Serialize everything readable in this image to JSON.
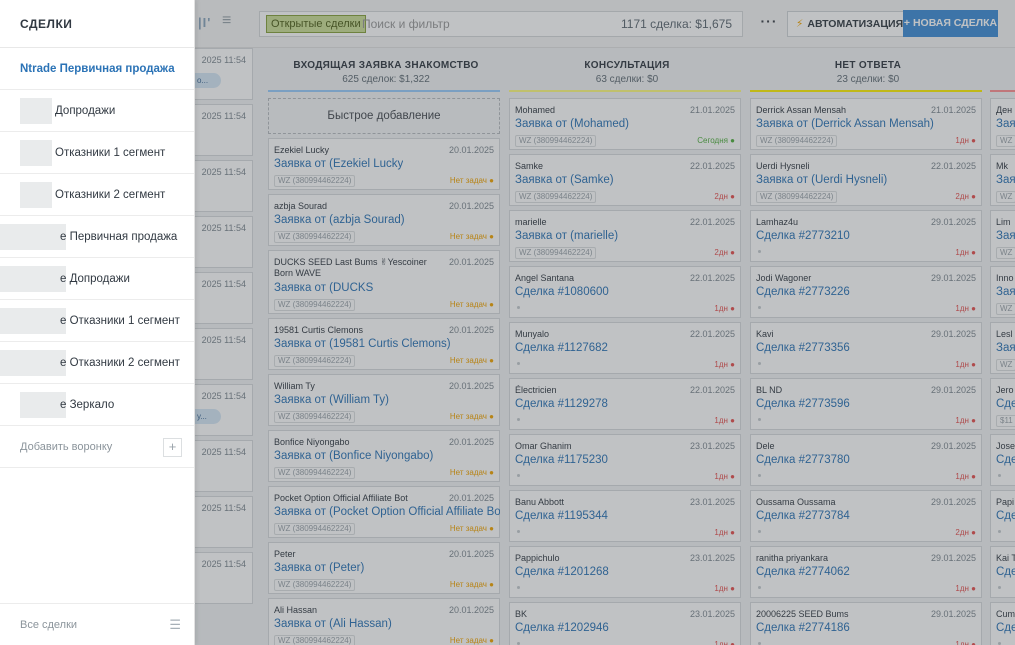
{
  "topbar": {
    "logo_text": "|I'",
    "filter_chip": "Открытые сделки",
    "search_placeholder": "Поиск и фильтр",
    "deal_count": "1171 сделка: $1,675",
    "more_label": "···",
    "automation_label": "АВТОМАТИЗАЦИЯ",
    "new_deal_label": "+ НОВАЯ СДЕЛКА"
  },
  "hidden_column": {
    "dates": [
      "2025 11:54",
      "2025 11:54",
      "2025 11:54",
      "2025 11:54",
      "2025 11:54",
      "2025 11:54",
      "2025 11:54",
      "2025 11:54",
      "2025 11:54",
      "2025 11:54"
    ],
    "badges": [
      "o...",
      "",
      "",
      "",
      "",
      "",
      "у...",
      "",
      "",
      ""
    ]
  },
  "columns": [
    {
      "title": "ВХОДЯЩАЯ ЗАЯВКА ЗНАКОМСТВО",
      "summary": "625 сделок: $1,322",
      "color": "#99ccfd",
      "quick_add": "Быстрое добавление",
      "cards": [
        {
          "name": "Ezekiel Lucky",
          "date": "20.01.2025",
          "title": "Заявка от (Ezekiel Lucky",
          "tag": "WZ (380994462224)",
          "status": "Нет задач",
          "status_color": "orange"
        },
        {
          "name": "azbja Sourad",
          "date": "20.01.2025",
          "title": "Заявка от (azbja Sourad)",
          "tag": "WZ (380994462224)",
          "status": "Нет задач",
          "status_color": "orange"
        },
        {
          "name": "DUCKS SEED Last Bums ✌Yescoiner Born WAVE",
          "date": "20.01.2025",
          "title": "Заявка от (DUCKS",
          "tag": "WZ (380994462224)",
          "status": "Нет задач",
          "status_color": "orange",
          "tall": true
        },
        {
          "name": "19581 Curtis Clemons",
          "date": "20.01.2025",
          "title": "Заявка от (19581 Curtis Clemons)",
          "tag": "WZ (380994462224)",
          "status": "Нет задач",
          "status_color": "orange"
        },
        {
          "name": "William Ty",
          "date": "20.01.2025",
          "title": "Заявка от (William Ty)",
          "tag": "WZ (380994462224)",
          "status": "Нет задач",
          "status_color": "orange"
        },
        {
          "name": "Bonfice Niyongabo",
          "date": "20.01.2025",
          "title": "Заявка от (Bonfice Niyongabo)",
          "tag": "WZ (380994462224)",
          "status": "Нет задач",
          "status_color": "orange"
        },
        {
          "name": "Pocket Option Official Affiliate Bot",
          "date": "20.01.2025",
          "title": "Заявка от (Pocket Option Official Affiliate Bot)",
          "tag": "WZ (380994462224)",
          "status": "Нет задач",
          "status_color": "orange"
        },
        {
          "name": "Peter",
          "date": "20.01.2025",
          "title": "Заявка от (Peter)",
          "tag": "WZ (380994462224)",
          "status": "Нет задач",
          "status_color": "orange"
        },
        {
          "name": "Ali Hassan",
          "date": "20.01.2025",
          "title": "Заявка от (Ali Hassan)",
          "tag": "WZ (380994462224)",
          "status": "Нет задач",
          "status_color": "orange"
        }
      ]
    },
    {
      "title": "КОНСУЛЬТАЦИЯ",
      "summary": "63 сделки: $0",
      "color": "#fffd7f",
      "cards": [
        {
          "name": "Mohamed",
          "date": "21.01.2025",
          "title": "Заявка от (Mohamed)",
          "tag": "WZ (380994462224)",
          "status": "Сегодня",
          "status_color": "green"
        },
        {
          "name": "Samke",
          "date": "22.01.2025",
          "title": "Заявка от (Samke)",
          "tag": "WZ (380994462224)",
          "status": "2дн",
          "status_color": "red"
        },
        {
          "name": "marielle",
          "date": "22.01.2025",
          "title": "Заявка от (marielle)",
          "tag": "WZ (380994462224)",
          "status": "2дн",
          "status_color": "red"
        },
        {
          "name": "Angel Santana",
          "date": "22.01.2025",
          "title": "Сделка #1080600",
          "tag": "",
          "status": "1дн",
          "status_color": "red"
        },
        {
          "name": "Munyalo",
          "date": "22.01.2025",
          "title": "Сделка #1127682",
          "tag": "",
          "status": "1дн",
          "status_color": "red"
        },
        {
          "name": "Électricien",
          "date": "22.01.2025",
          "title": "Сделка #1129278",
          "tag": "",
          "status": "1дн",
          "status_color": "red"
        },
        {
          "name": "Omar Ghanim",
          "date": "23.01.2025",
          "title": "Сделка #1175230",
          "tag": "",
          "status": "1дн",
          "status_color": "red"
        },
        {
          "name": "Banu Abbott",
          "date": "23.01.2025",
          "title": "Сделка #1195344",
          "tag": "",
          "status": "1дн",
          "status_color": "red"
        },
        {
          "name": "Pappichulo",
          "date": "23.01.2025",
          "title": "Сделка #1201268",
          "tag": "",
          "status": "1дн",
          "status_color": "red"
        },
        {
          "name": "BK",
          "date": "23.01.2025",
          "title": "Сделка #1202946",
          "tag": "",
          "status": "1дн",
          "status_color": "red"
        }
      ]
    },
    {
      "title": "НЕТ ОТВЕТА",
      "summary": "23 сделки: $0",
      "color": "#fff000",
      "cards": [
        {
          "name": "Derrick Assan Mensah",
          "date": "21.01.2025",
          "title": "Заявка от (Derrick Assan Mensah)",
          "tag": "WZ (380994462224)",
          "status": "1дн",
          "status_color": "red"
        },
        {
          "name": "Uerdi Hysneli",
          "date": "22.01.2025",
          "title": "Заявка от (Uerdi Hysneli)",
          "tag": "WZ (380994462224)",
          "status": "2дн",
          "status_color": "red"
        },
        {
          "name": "Lamhaz4u",
          "date": "29.01.2025",
          "title": "Сделка #2773210",
          "tag": "",
          "status": "1дн",
          "status_color": "red"
        },
        {
          "name": "Jodi Wagoner",
          "date": "29.01.2025",
          "title": "Сделка #2773226",
          "tag": "",
          "status": "1дн",
          "status_color": "red"
        },
        {
          "name": "Kavi",
          "date": "29.01.2025",
          "title": "Сделка #2773356",
          "tag": "",
          "status": "1дн",
          "status_color": "red"
        },
        {
          "name": "BL ND",
          "date": "29.01.2025",
          "title": "Сделка #2773596",
          "tag": "",
          "status": "1дн",
          "status_color": "red"
        },
        {
          "name": "Dele",
          "date": "29.01.2025",
          "title": "Сделка #2773780",
          "tag": "",
          "status": "1дн",
          "status_color": "red"
        },
        {
          "name": "Oussama Oussama",
          "date": "29.01.2025",
          "title": "Сделка #2773784",
          "tag": "",
          "status": "2дн",
          "status_color": "red"
        },
        {
          "name": "ranitha priyankara",
          "date": "29.01.2025",
          "title": "Сделка #2774062",
          "tag": "",
          "status": "1дн",
          "status_color": "red"
        },
        {
          "name": "20006225 SEED Bums",
          "date": "29.01.2025",
          "title": "Сделка #2774186",
          "tag": "",
          "status": "1дн",
          "status_color": "red"
        }
      ]
    },
    {
      "title": "",
      "summary": "",
      "color": "#ff8f92",
      "cards": [
        {
          "name": "Ден",
          "date": "",
          "title": "Заяв",
          "tag": "WZ",
          "status": "",
          "status_color": "red"
        },
        {
          "name": "Mk",
          "date": "",
          "title": "Заяв",
          "tag": "WZ",
          "status": "",
          "status_color": "red"
        },
        {
          "name": "Lim",
          "date": "",
          "title": "Заяв",
          "tag": "WZ",
          "status": "",
          "status_color": "red"
        },
        {
          "name": "Inno",
          "date": "",
          "title": "Заяв",
          "tag": "WZ",
          "status": "",
          "status_color": "red"
        },
        {
          "name": "Lesl",
          "date": "",
          "title": "Заяв",
          "tag": "WZ",
          "status": "",
          "status_color": "red"
        },
        {
          "name": "Jero",
          "date": "",
          "title": "Сде",
          "tag": "$11",
          "status": "",
          "status_color": "red"
        },
        {
          "name": "Jose",
          "date": "",
          "title": "Сде",
          "tag": "",
          "status": "",
          "status_color": "red"
        },
        {
          "name": "Papi",
          "date": "",
          "title": "Сде",
          "tag": "",
          "status": "",
          "status_color": "red"
        },
        {
          "name": "Kai T",
          "date": "",
          "title": "Сде",
          "tag": "",
          "status": "",
          "status_color": "red"
        },
        {
          "name": "Cum",
          "date": "",
          "title": "Сде",
          "tag": "",
          "status": "",
          "status_color": "red"
        }
      ]
    }
  ],
  "panel": {
    "header": "СДЕЛКИ",
    "active_item": "Ntrade Первичная продажа",
    "items": [
      {
        "label": "Допродажи"
      },
      {
        "label": "Отказники 1 сегмент"
      },
      {
        "label": "Отказники 2 сегмент"
      },
      {
        "label": "е Первичная продажа"
      },
      {
        "label": "е Допродажи"
      },
      {
        "label": "е Отказники 1 сегмент"
      },
      {
        "label": "е Отказники 2 сегмент"
      },
      {
        "label": "е Зеркало"
      }
    ],
    "add_pipeline": "Добавить воронку",
    "add_plus": "+",
    "all_deals": "Все сделки",
    "menu_glyph": "☰"
  }
}
